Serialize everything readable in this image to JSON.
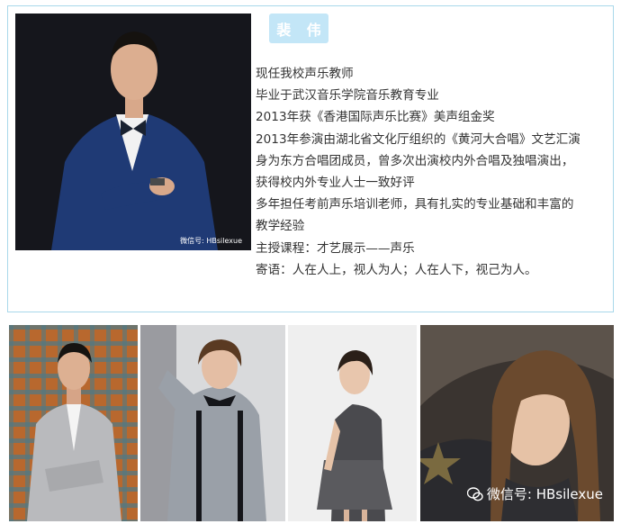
{
  "teacher": {
    "name": "裴 伟",
    "bio_lines": [
      "现任我校声乐教师",
      "毕业于武汉音乐学院音乐教育专业",
      "2013年获《香港国际声乐比赛》美声组金奖",
      "2013年参演由湖北省文化厅组织的《黄河大合唱》文艺汇演",
      "身为东方合唱团成员，曾多次出演校内外合唱及独唱演出，",
      "获得校内外专业人士一致好评",
      "多年担任考前声乐培训老师，具有扎实的专业基础和丰富的",
      "教学经验",
      "主授课程：才艺展示——声乐",
      "寄语：人在人上，视人为人；人在人下，视己为人。"
    ]
  },
  "watermarks": {
    "portrait": "微信号: HBsilexue",
    "gallery": "微信号: HBsilexue"
  },
  "colors": {
    "border": "#a8d8ea",
    "badge_bg": "#c3e6f7",
    "text": "#333333"
  },
  "icons": [
    "wechat-icon"
  ]
}
